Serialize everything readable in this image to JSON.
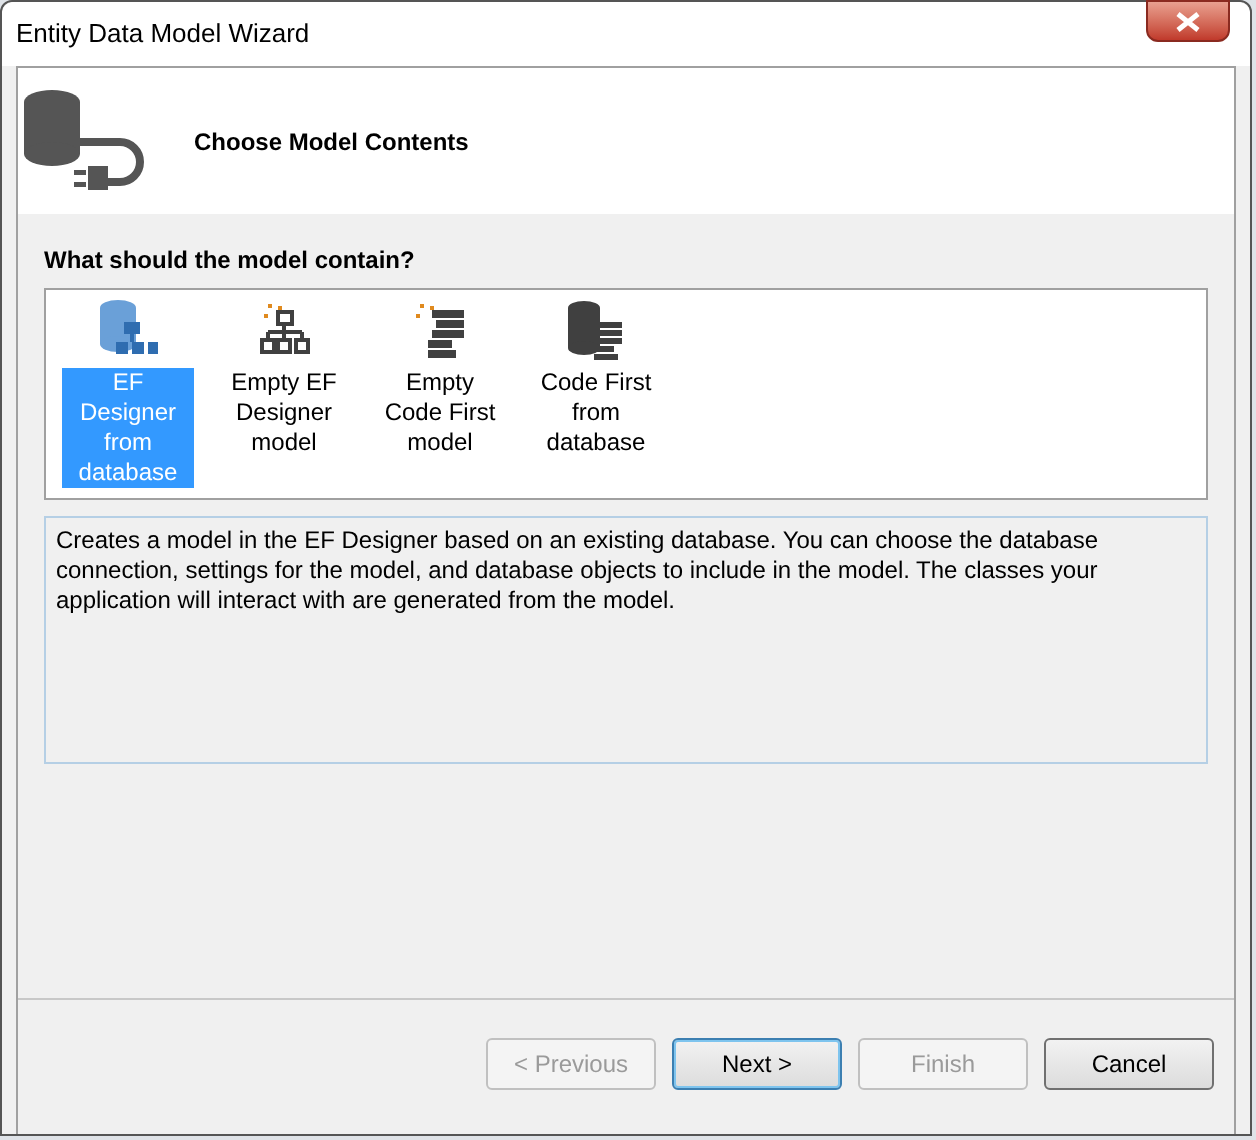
{
  "window": {
    "title": "Entity Data Model Wizard"
  },
  "header": {
    "title": "Choose Model Contents"
  },
  "prompt": "What should the model contain?",
  "options": [
    {
      "kind": "db-diagram",
      "label": "EF Designer from database",
      "selected": true
    },
    {
      "kind": "diagram",
      "label": "Empty EF Designer model",
      "selected": false
    },
    {
      "kind": "code",
      "label": "Empty Code First model",
      "selected": false
    },
    {
      "kind": "db-code",
      "label": "Code First from database",
      "selected": false
    }
  ],
  "description": "Creates a model in the EF Designer based on an existing database. You can choose the database connection, settings for the model, and database objects to include in the model. The classes your application will interact with are generated from the model.",
  "buttons": [
    {
      "label": "< Previous",
      "disabled": true,
      "default": false
    },
    {
      "label": "Next >",
      "disabled": false,
      "default": true
    },
    {
      "label": "Finish",
      "disabled": true,
      "default": false
    },
    {
      "label": "Cancel",
      "disabled": false,
      "default": false
    }
  ]
}
